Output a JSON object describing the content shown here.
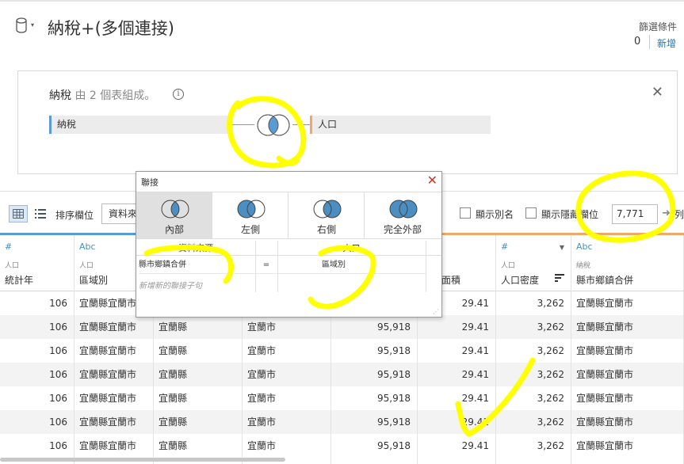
{
  "header": {
    "title": "納稅+(多個連接)",
    "filters_label": "篩選條件",
    "filters_count": "0",
    "filters_add": "新增"
  },
  "canvas": {
    "label_main": "納稅",
    "label_suffix": "由 2 個表組成。",
    "left_table": "納稅",
    "right_table": "人口"
  },
  "toolbar": {
    "sort_label": "排序欄位",
    "sort_value": "資料來源順序",
    "show_alias": "顯示別名",
    "show_hidden": "顯示隱藏欄位",
    "rows": "7,771",
    "rows_suffix": "列"
  },
  "join_dialog": {
    "title": "聯接",
    "types": [
      "內部",
      "左側",
      "右側",
      "完全外部"
    ],
    "selected": "內部",
    "col_left": "資料來源",
    "col_right": "人口",
    "clause_left": "縣市鄉鎮合併",
    "operator": "=",
    "clause_right": "區域別",
    "new_clause": "新增新的聯接子句"
  },
  "columns": [
    {
      "type": "#",
      "source": "人口",
      "name": "統計年",
      "width": 94,
      "align": "num"
    },
    {
      "type": "Abc",
      "source": "人口",
      "name": "區域別",
      "width": 100,
      "align": "text"
    },
    {
      "type": "",
      "source": "",
      "name": "",
      "width": 112,
      "align": "text"
    },
    {
      "type": "",
      "source": "",
      "name": "",
      "width": 112,
      "align": "text"
    },
    {
      "type": "",
      "source": "",
      "name": "",
      "width": 109,
      "align": "num"
    },
    {
      "type": "",
      "source": "",
      "name": "土地面積",
      "width": 99,
      "align": "num"
    },
    {
      "type": "#",
      "source": "人口",
      "name": "人口密度",
      "width": 95,
      "align": "num"
    },
    {
      "type": "Abc",
      "source": "納稅",
      "name": "縣市鄉鎮合併",
      "width": 142,
      "align": "text"
    }
  ],
  "rows": [
    [
      "106",
      "宜蘭縣宜蘭市",
      "",
      "",
      "",
      "29.41",
      "3,262",
      "宜蘭縣宜蘭市"
    ],
    [
      "106",
      "宜蘭縣宜蘭市",
      "宜蘭縣",
      "宜蘭市",
      "95,918",
      "29.41",
      "3,262",
      "宜蘭縣宜蘭市"
    ],
    [
      "106",
      "宜蘭縣宜蘭市",
      "宜蘭縣",
      "宜蘭市",
      "95,918",
      "29.41",
      "3,262",
      "宜蘭縣宜蘭市"
    ],
    [
      "106",
      "宜蘭縣宜蘭市",
      "宜蘭縣",
      "宜蘭市",
      "95,918",
      "29.41",
      "3,262",
      "宜蘭縣宜蘭市"
    ],
    [
      "106",
      "宜蘭縣宜蘭市",
      "宜蘭縣",
      "宜蘭市",
      "95,918",
      "29.41",
      "3,262",
      "宜蘭縣宜蘭市"
    ],
    [
      "106",
      "宜蘭縣宜蘭市",
      "宜蘭縣",
      "宜蘭市",
      "95,918",
      "29.41",
      "3,262",
      "宜蘭縣宜蘭市"
    ],
    [
      "106",
      "宜蘭縣宜蘭市",
      "宜蘭縣",
      "宜蘭市",
      "95,918",
      "29.41",
      "3,262",
      "宜蘭縣宜蘭市"
    ]
  ],
  "colors": {
    "accent": "#4a8ec2",
    "left_table": "#5b9bd5",
    "right_table": "#f0a868",
    "annotation": "#ffff00"
  }
}
